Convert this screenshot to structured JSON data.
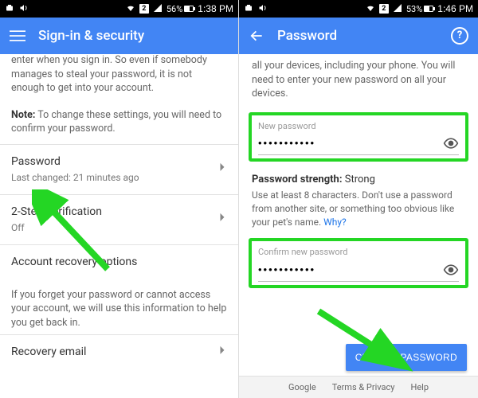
{
  "left": {
    "status": {
      "battery_pct": "56%",
      "time": "1:38 PM",
      "sim": "2"
    },
    "appbar": {
      "title": "Sign-in & security"
    },
    "intro_line1": "enter when you sign in. So even if somebody manages to steal your password, it is not enough to get into your account.",
    "note_label": "Note:",
    "note_text": " To change these settings, you will need to confirm your password.",
    "password_row": {
      "title": "Password",
      "sub": "Last changed: 21 minutes ago"
    },
    "twostep_row": {
      "title": "2-Step Verification",
      "sub": "Off"
    },
    "recovery_header": "Account recovery options",
    "recovery_desc": "If you forget your password or cannot access your account, we will use this information to help you get back in.",
    "recovery_email_row": "Recovery email"
  },
  "right": {
    "status": {
      "battery_pct": "53%",
      "time": "1:46 PM",
      "sim": "2"
    },
    "appbar": {
      "title": "Password"
    },
    "intro": "all your devices, including your phone. You will need to enter your new password on all your devices.",
    "new_pw": {
      "label": "New password",
      "value": "•••••••••••"
    },
    "strength_label": "Password strength:",
    "strength_value": " Strong",
    "tips": "Use at least 8 characters. Don't use a password from another site, or something too obvious like your pet's name. ",
    "why_link": "Why?",
    "confirm_pw": {
      "label": "Confirm new password",
      "value": "•••••••••••"
    },
    "change_btn": "CHANGE PASSWORD",
    "footer": {
      "google": "Google",
      "terms": "Terms & Privacy",
      "help": "Help"
    }
  }
}
